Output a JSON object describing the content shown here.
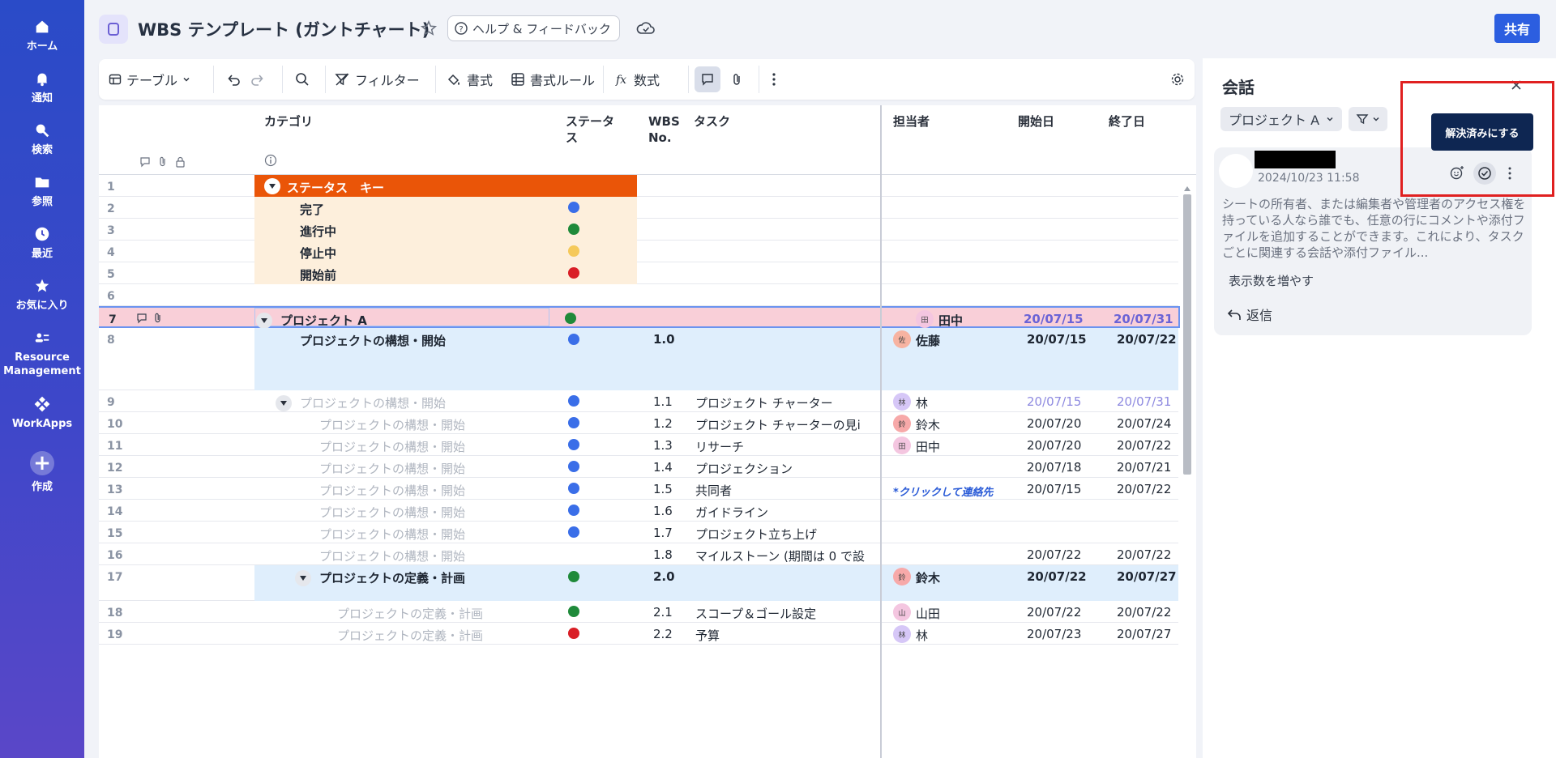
{
  "nav": {
    "home": "ホーム",
    "notify": "通知",
    "search": "検索",
    "browse": "参照",
    "recent": "最近",
    "favorites": "お気に入り",
    "resource": "Resource Management",
    "workapps": "WorkApps",
    "create": "作成"
  },
  "header": {
    "title": "WBS テンプレート (ガントチャート)",
    "help": "ヘルプ & フィードバック",
    "share": "共有"
  },
  "toolbar": {
    "view": "テーブル",
    "filter": "フィルター",
    "format": "書式",
    "format_rules": "書式ルール",
    "formula": "数式"
  },
  "columns": {
    "category": "カテゴリ",
    "status": "ステータス",
    "wbs": "WBS No.",
    "task": "タスク",
    "assignee": "担当者",
    "start": "開始日",
    "end": "終了日"
  },
  "rows": [
    {
      "num": "1",
      "category": "ステータス　キー"
    },
    {
      "num": "2",
      "category": "完了",
      "status_color": "#3a6ee8"
    },
    {
      "num": "3",
      "category": "進行中",
      "status_color": "#1f8a3a"
    },
    {
      "num": "4",
      "category": "停止中",
      "status_color": "#f5c95a"
    },
    {
      "num": "5",
      "category": "開始前",
      "status_color": "#d91e26"
    },
    {
      "num": "6"
    },
    {
      "num": "7",
      "category": "プロジェクト A",
      "status_color": "#1f8a3a",
      "assignee": "田中",
      "start": "20/07/15",
      "end": "20/07/31"
    },
    {
      "num": "8",
      "category": "プロジェクトの構想・開始",
      "status_color": "#3a6ee8",
      "wbs": "1.0",
      "assignee": "佐藤",
      "start": "20/07/15",
      "end": "20/07/22"
    },
    {
      "num": "9",
      "category": "プロジェクトの構想・開始",
      "status_color": "#3a6ee8",
      "wbs": "1.1",
      "task": "プロジェクト チャーター",
      "assignee": "林",
      "start": "20/07/15",
      "end": "20/07/31"
    },
    {
      "num": "10",
      "category": "プロジェクトの構想・開始",
      "status_color": "#3a6ee8",
      "wbs": "1.2",
      "task": "プロジェクト チャーターの見i",
      "assignee": "鈴木",
      "start": "20/07/20",
      "end": "20/07/24"
    },
    {
      "num": "11",
      "category": "プロジェクトの構想・開始",
      "status_color": "#3a6ee8",
      "wbs": "1.3",
      "task": "リサーチ",
      "assignee": "田中",
      "start": "20/07/20",
      "end": "20/07/22"
    },
    {
      "num": "12",
      "category": "プロジェクトの構想・開始",
      "status_color": "#3a6ee8",
      "wbs": "1.4",
      "task": "プロジェクション",
      "start": "20/07/18",
      "end": "20/07/21"
    },
    {
      "num": "13",
      "category": "プロジェクトの構想・開始",
      "status_color": "#3a6ee8",
      "wbs": "1.5",
      "task": "共同者",
      "assignee_link": "*クリックして連絡先",
      "start": "20/07/15",
      "end": "20/07/22"
    },
    {
      "num": "14",
      "category": "プロジェクトの構想・開始",
      "status_color": "#3a6ee8",
      "wbs": "1.6",
      "task": "ガイドライン"
    },
    {
      "num": "15",
      "category": "プロジェクトの構想・開始",
      "status_color": "#3a6ee8",
      "wbs": "1.7",
      "task": "プロジェクト立ち上げ"
    },
    {
      "num": "16",
      "category": "プロジェクトの構想・開始",
      "wbs": "1.8",
      "task": "マイルストーン (期間は 0 で設",
      "start": "20/07/22",
      "end": "20/07/22"
    },
    {
      "num": "17",
      "category": "プロジェクトの定義・計画",
      "status_color": "#1f8a3a",
      "wbs": "2.0",
      "assignee": "鈴木",
      "start": "20/07/22",
      "end": "20/07/27"
    },
    {
      "num": "18",
      "category": "プロジェクトの定義・計画",
      "status_color": "#1f8a3a",
      "wbs": "2.1",
      "task": "スコープ＆ゴール設定",
      "assignee": "山田",
      "start": "20/07/22",
      "end": "20/07/22"
    },
    {
      "num": "19",
      "category": "プロジェクトの定義・計画",
      "status_color": "#d91e26",
      "wbs": "2.2",
      "task": "予算",
      "assignee": "林",
      "start": "20/07/23",
      "end": "20/07/27"
    }
  ],
  "avatars": {
    "田中": {
      "initial": "田",
      "color": "#f4c6e0"
    },
    "佐藤": {
      "initial": "佐",
      "color": "#f7b3a1"
    },
    "林": {
      "initial": "林",
      "color": "#d6c7f7"
    },
    "鈴木": {
      "initial": "鈴",
      "color": "#f7a9a9"
    },
    "山田": {
      "initial": "山",
      "color": "#f4c6e0"
    }
  },
  "panel": {
    "title": "会話",
    "project_filter": "プロジェクト A",
    "comment_time": "2024/10/23 11:58",
    "comment_body": "シートの所有者、または編集者や管理者のアクセス権を持っている人なら誰でも、任意の行にコメントや添付ファイルを追加することができます。これにより、タスクごとに関連する会話や添付ファイル...",
    "show_more": "表示数を増やす",
    "reply": "返信",
    "tooltip": "解決済みにする"
  }
}
